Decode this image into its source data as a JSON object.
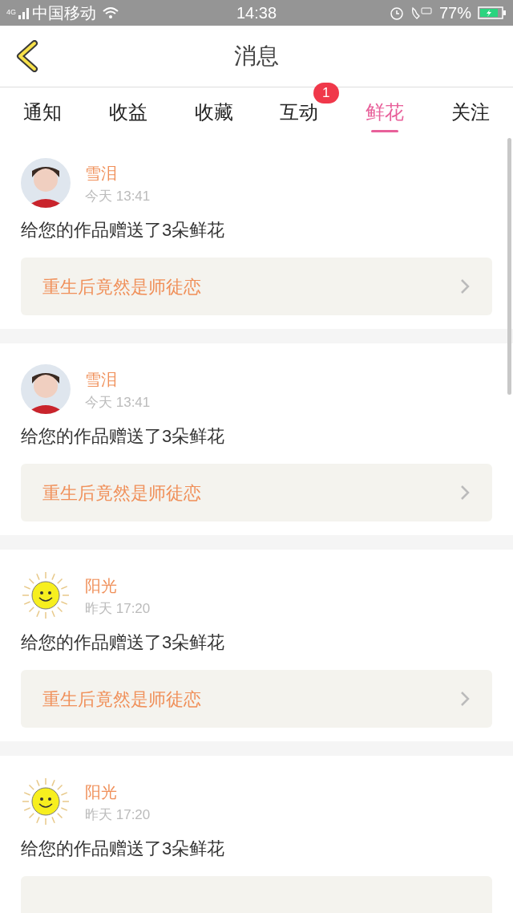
{
  "status_bar": {
    "network": "4G",
    "carrier": "中国移动",
    "time": "14:38",
    "battery": "77%"
  },
  "header": {
    "title": "消息"
  },
  "tabs": [
    {
      "label": "通知",
      "selected": false
    },
    {
      "label": "收益",
      "selected": false
    },
    {
      "label": "收藏",
      "selected": false
    },
    {
      "label": "互动",
      "selected": false,
      "badge": "1"
    },
    {
      "label": "鲜花",
      "selected": true
    },
    {
      "label": "关注",
      "selected": false
    }
  ],
  "messages": [
    {
      "avatar": {
        "kind": "photo"
      },
      "name": "雪泪",
      "time": "今天 13:41",
      "text": "给您的作品赠送了3朵鲜花",
      "work": {
        "title": "重生后竟然是师徒恋"
      }
    },
    {
      "avatar": {
        "kind": "photo"
      },
      "name": "雪泪",
      "time": "今天 13:41",
      "text": "给您的作品赠送了3朵鲜花",
      "work": {
        "title": "重生后竟然是师徒恋"
      }
    },
    {
      "avatar": {
        "kind": "sun"
      },
      "name": "阳光",
      "time": "昨天 17:20",
      "text": "给您的作品赠送了3朵鲜花",
      "work": {
        "title": "重生后竟然是师徒恋"
      }
    },
    {
      "avatar": {
        "kind": "sun"
      },
      "name": "阳光",
      "time": "昨天 17:20",
      "text": "给您的作品赠送了3朵鲜花"
    }
  ]
}
